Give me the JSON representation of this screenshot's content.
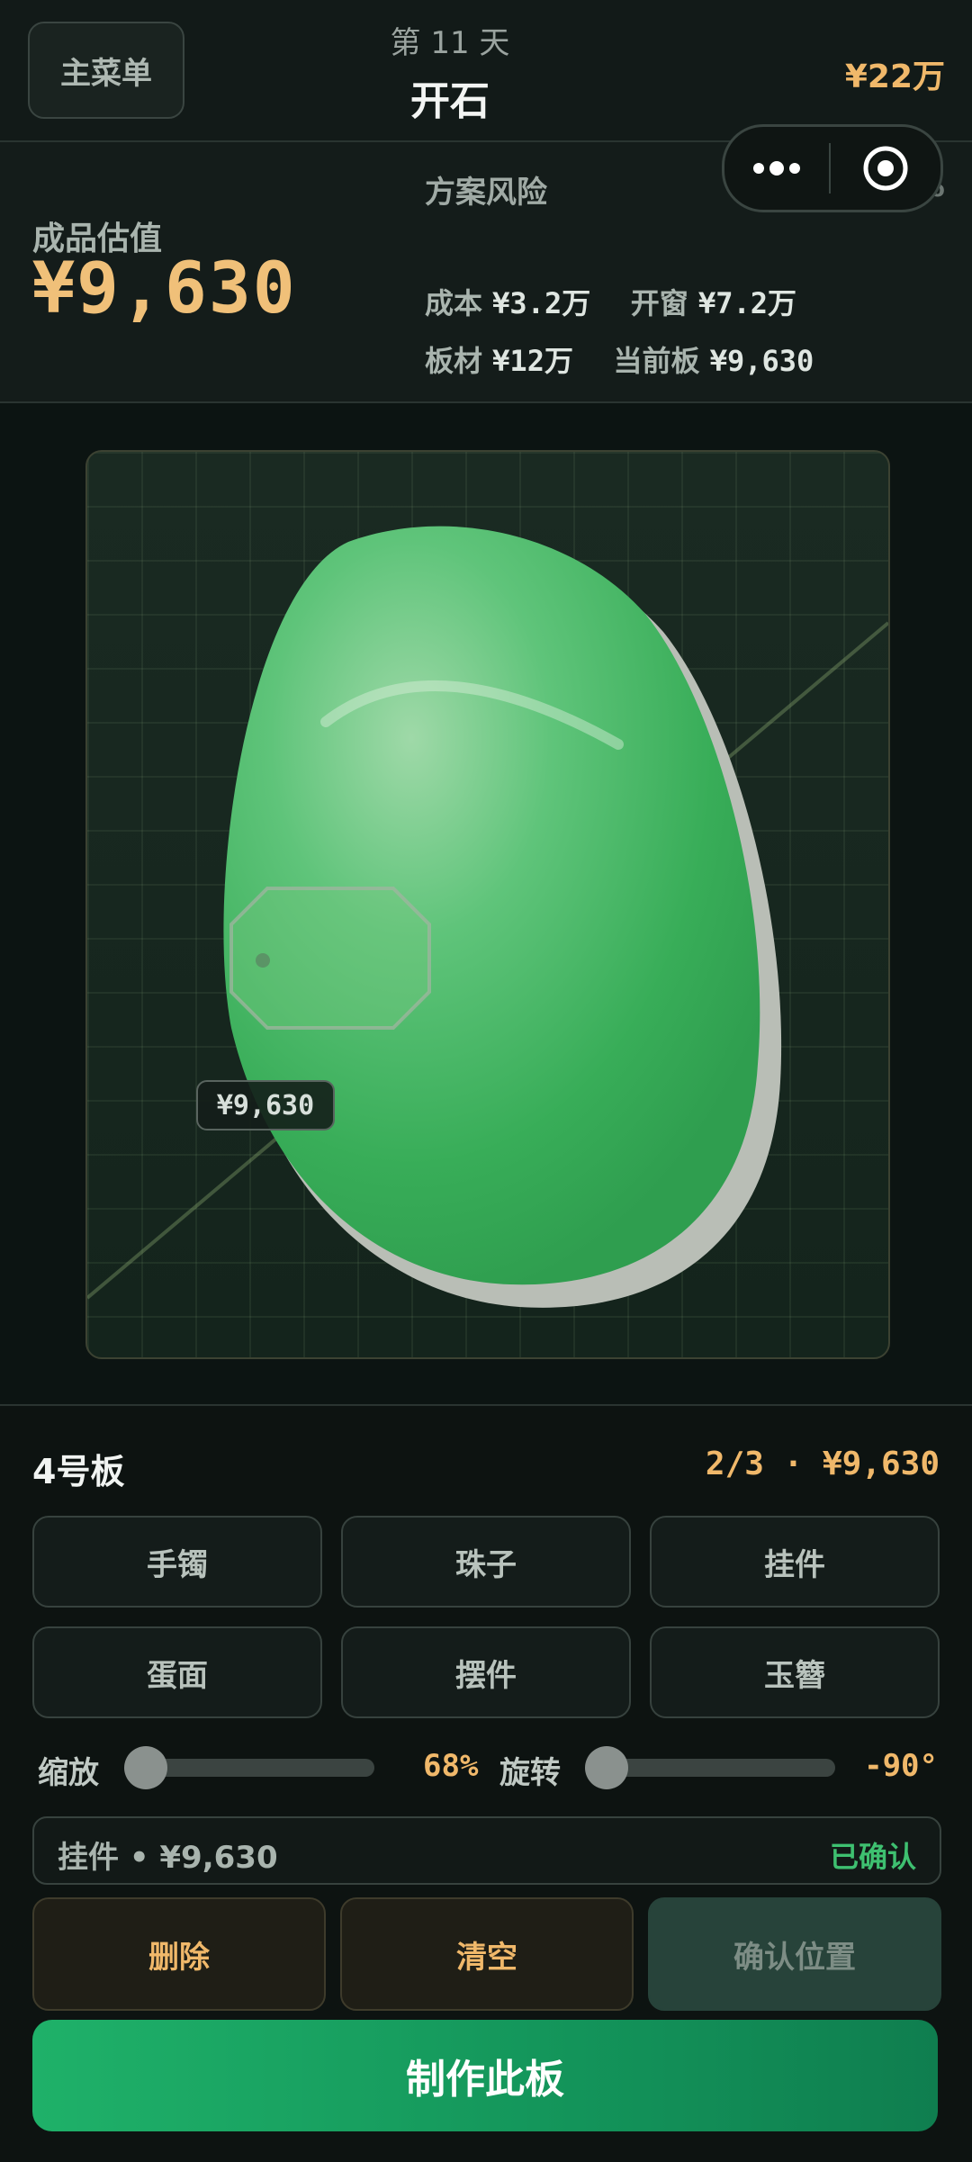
{
  "header": {
    "menu_label": "主菜单",
    "day_label": "第 11 天",
    "phase_title": "开石",
    "money": "¥22万"
  },
  "stats": {
    "estimate_label": "成品估值",
    "estimate_value": "¥9,630",
    "risk_label": "方案风险",
    "risk_value": "0%",
    "cost_label": "成本",
    "cost_value": "¥3.2万",
    "window_label": "开窗",
    "window_value": "¥7.2万",
    "slab_label": "板材",
    "slab_value": "¥12万",
    "current_label": "当前板",
    "current_value": "¥9,630"
  },
  "stage": {
    "piece_price": "¥9,630"
  },
  "panel": {
    "slab_name": "4号板",
    "slab_progress": "2/3 · ¥9,630",
    "categories": [
      "手镯",
      "珠子",
      "挂件",
      "蛋面",
      "摆件",
      "玉簪"
    ],
    "zoom_label": "缩放",
    "zoom_value": "68%",
    "rotate_label": "旋转",
    "rotate_value": "-90°",
    "selection_text": "挂件 • ¥9,630",
    "selection_status": "已确认",
    "delete_label": "删除",
    "clear_label": "清空",
    "confirm_label": "确认位置",
    "make_label": "制作此板"
  },
  "colors": {
    "accent_gold": "#f0b86a",
    "accent_green": "#1fb169",
    "confirmed_green": "#3ec070",
    "jade": "#3fbf63"
  },
  "icons": {
    "capsule_more": "more-dots-icon",
    "capsule_target": "target-icon"
  }
}
